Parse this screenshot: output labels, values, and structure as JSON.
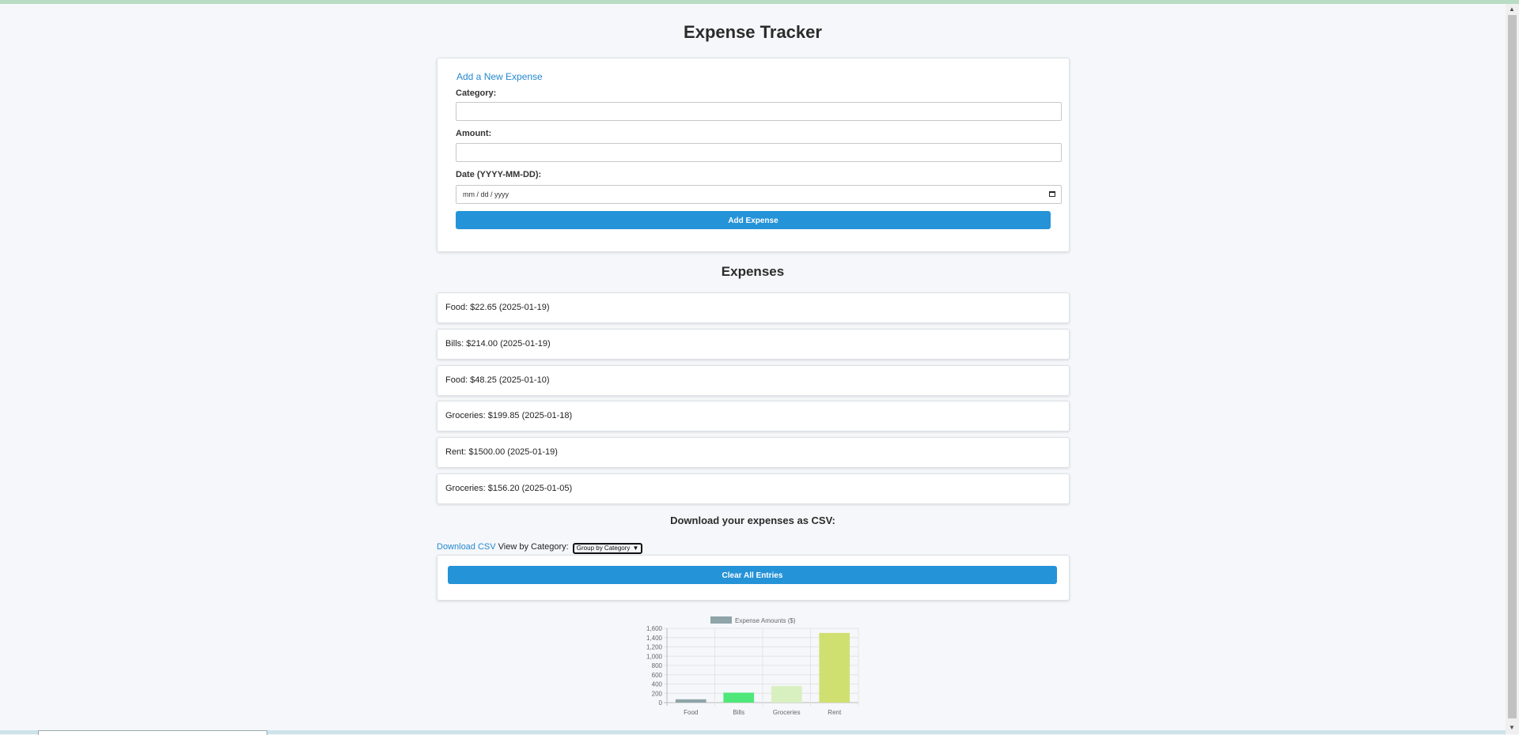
{
  "header": {
    "title": "Expense Tracker"
  },
  "form": {
    "title": "Add a New Expense",
    "category_label": "Category:",
    "category_value": "",
    "amount_label": "Amount:",
    "amount_value": "",
    "date_label": "Date (YYYY-MM-DD):",
    "date_placeholder": "mm / dd / yyyy",
    "submit_label": "Add Expense"
  },
  "expenses": {
    "heading": "Expenses",
    "items": [
      {
        "text": "Food: $22.65 (2025-01-19)"
      },
      {
        "text": "Bills: $214.00 (2025-01-19)"
      },
      {
        "text": "Food: $48.25 (2025-01-10)"
      },
      {
        "text": "Groceries: $199.85 (2025-01-18)"
      },
      {
        "text": "Rent: $1500.00 (2025-01-19)"
      },
      {
        "text": "Groceries: $156.20 (2025-01-05)"
      }
    ]
  },
  "download": {
    "heading": "Download your expenses as CSV:",
    "link_label": "Download CSV",
    "view_label": "View by Category:",
    "select_value": "Group by Category"
  },
  "clear": {
    "label": "Clear All Entries"
  },
  "chart_data": {
    "type": "bar",
    "categories": [
      "Food",
      "Bills",
      "Groceries",
      "Rent"
    ],
    "series": [
      {
        "name": "Expense Amounts ($)",
        "values": [
          70.9,
          214.0,
          356.05,
          1500.0
        ]
      }
    ],
    "bar_colors": [
      "#8fa4a8",
      "#4ee87a",
      "#d8f0c0",
      "#d0e070"
    ],
    "legend_color": "#8fa4a8",
    "ylim": [
      0,
      1600
    ],
    "yticks": [
      "0",
      "200",
      "400",
      "600",
      "800",
      "1,000",
      "1,200",
      "1,400",
      "1,600"
    ],
    "grid": true,
    "legend_position": "top"
  }
}
